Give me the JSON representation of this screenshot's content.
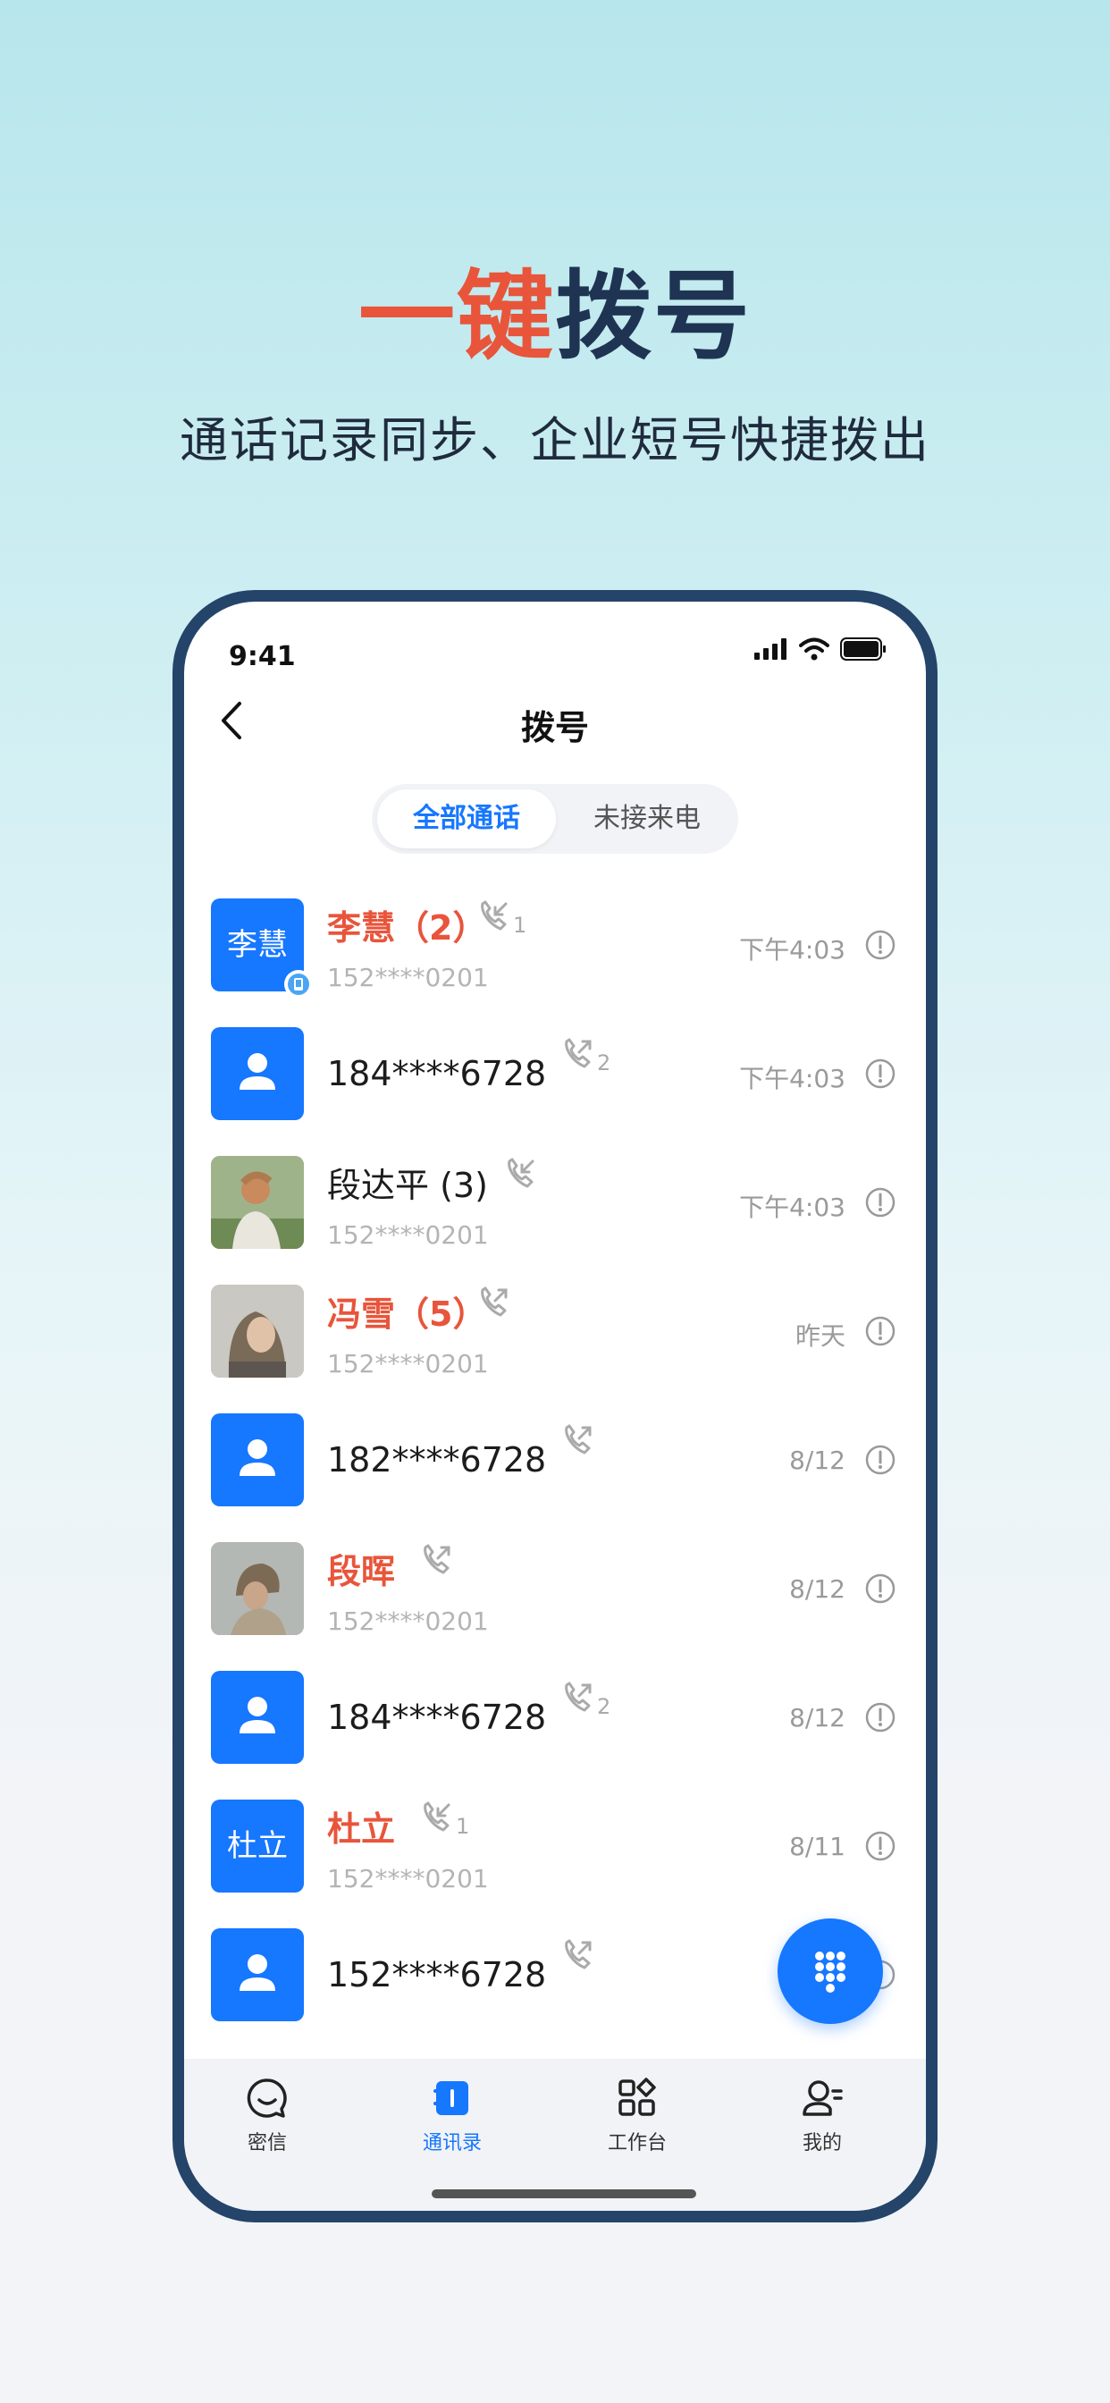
{
  "hero": {
    "title_accent": "一键",
    "title_dark": "拨号",
    "subtitle": "通话记录同步、企业短号快捷拨出"
  },
  "status": {
    "time": "9:41"
  },
  "nav": {
    "title": "拨号"
  },
  "segments": {
    "all": "全部通话",
    "missed": "未接来电"
  },
  "calls": [
    {
      "avatar_text": "李慧",
      "name": "李慧（2）",
      "missed": true,
      "sub": "152****0201",
      "count": "1",
      "time": "下午4:03"
    },
    {
      "avatar_text": "",
      "name": "184****6728",
      "missed": false,
      "sub": "",
      "count": "2",
      "time": "下午4:03"
    },
    {
      "avatar_text": "",
      "name": "段达平 (3)",
      "missed": false,
      "sub": "152****0201",
      "count": "",
      "time": "下午4:03"
    },
    {
      "avatar_text": "",
      "name": "冯雪（5）",
      "missed": true,
      "sub": "152****0201",
      "count": "",
      "time": "昨天"
    },
    {
      "avatar_text": "",
      "name": "182****6728",
      "missed": false,
      "sub": "",
      "count": "",
      "time": "8/12"
    },
    {
      "avatar_text": "",
      "name": "段晖",
      "missed": true,
      "sub": "152****0201",
      "count": "",
      "time": "8/12"
    },
    {
      "avatar_text": "",
      "name": "184****6728",
      "missed": false,
      "sub": "",
      "count": "2",
      "time": "8/12"
    },
    {
      "avatar_text": "杜立",
      "name": "杜立",
      "missed": true,
      "sub": "152****0201",
      "count": "1",
      "time": "8/11"
    },
    {
      "avatar_text": "",
      "name": "152****6728",
      "missed": false,
      "sub": "",
      "count": "",
      "time": ""
    }
  ],
  "tabbar": {
    "messages": "密信",
    "contacts": "通讯录",
    "workbench": "工作台",
    "mine": "我的"
  },
  "colors": {
    "accent": "#1677ff",
    "missed": "#e8553b",
    "frame": "#24446a"
  }
}
